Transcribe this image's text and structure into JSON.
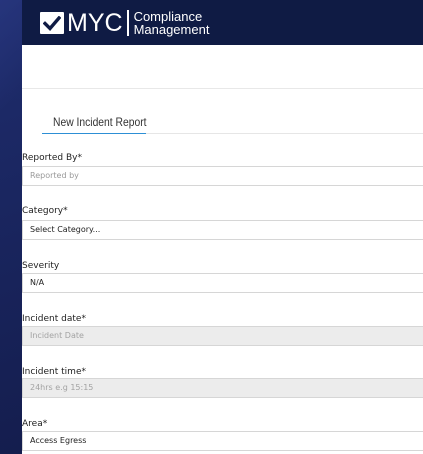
{
  "header": {
    "brand": "MYC",
    "brand_sub_line1": "Compliance",
    "brand_sub_line2": "Management"
  },
  "form": {
    "title": "New Incident Report",
    "fields": [
      {
        "label": "Reported By*",
        "value": "",
        "placeholder": "Reported by",
        "type": "text"
      },
      {
        "label": "Category*",
        "value": "Select Category...",
        "type": "select"
      },
      {
        "label": "Severity",
        "value": "N/A",
        "type": "select"
      },
      {
        "label": "Incident date*",
        "value": "",
        "placeholder": "Incident Date",
        "type": "date",
        "disabled": true
      },
      {
        "label": "Incident time*",
        "value": "",
        "placeholder": "24hrs e.g 15:15",
        "type": "time",
        "disabled": true
      },
      {
        "label": "Area*",
        "value": "Access Egress",
        "type": "select"
      }
    ]
  },
  "colors": {
    "background": "#1a2560",
    "header": "#0f1b44",
    "accent": "#2d8fd5",
    "disabled_field": "#ececec"
  }
}
